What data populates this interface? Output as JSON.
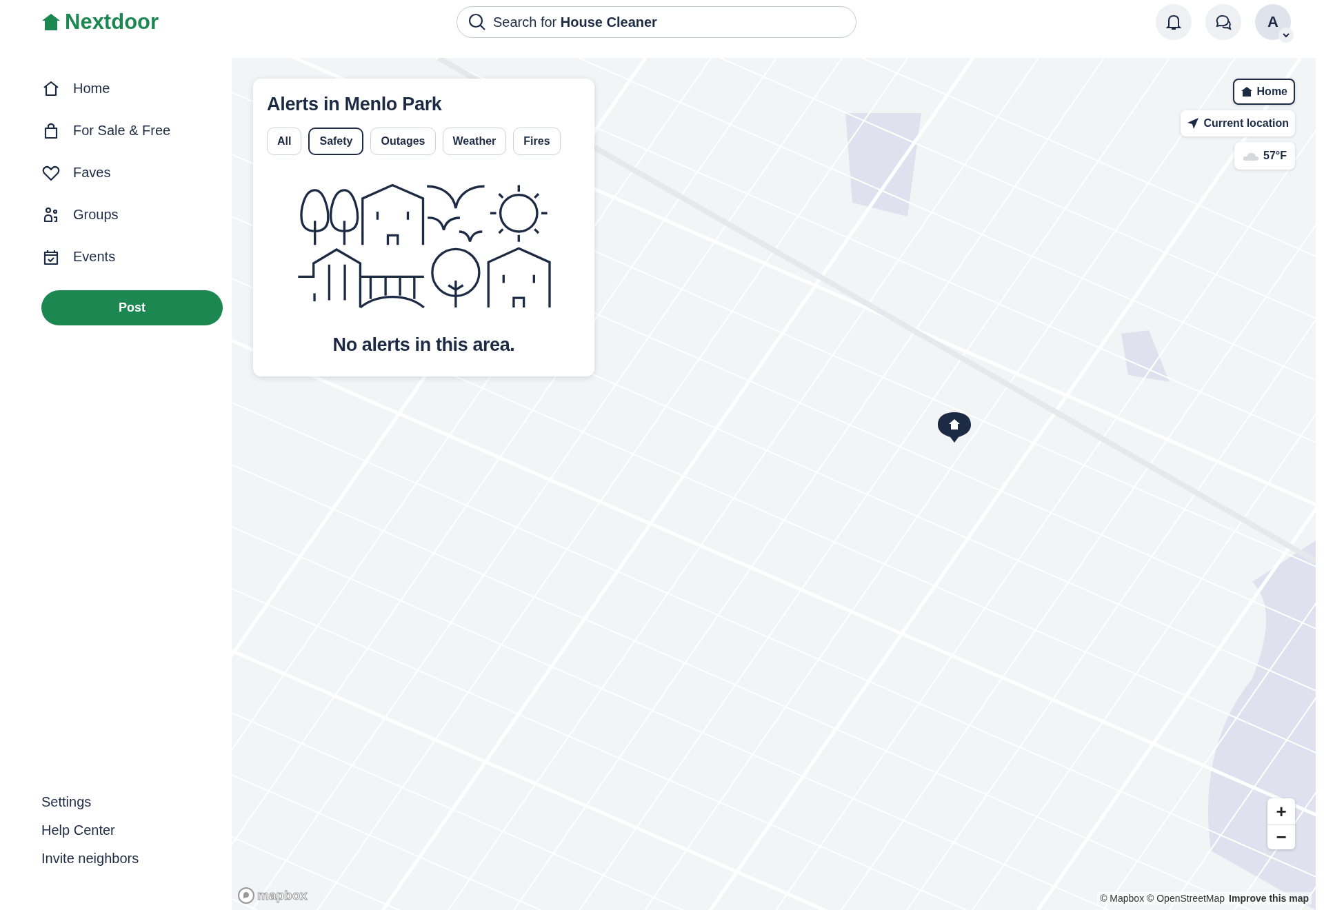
{
  "header": {
    "logo": "Nextdoor",
    "search": "Search for **House Cleaner**",
    "avatar": "A"
  },
  "sidebar": {
    "nav": [
      {
        "label": "Home",
        "kind": "home"
      },
      {
        "label": "For Sale & Free",
        "kind": "bag"
      },
      {
        "label": "Faves",
        "kind": "heart"
      },
      {
        "label": "Groups",
        "kind": "people"
      },
      {
        "label": "Events",
        "kind": "calendar"
      }
    ],
    "post": "Post",
    "footer_links": [
      "Settings",
      "Help Center",
      "Invite neighbors"
    ]
  },
  "alerts": {
    "title": "Alerts in Menlo Park",
    "filters": [
      {
        "label": "All",
        "selected": false
      },
      {
        "label": "Safety",
        "selected": true
      },
      {
        "label": "Outages",
        "selected": false
      },
      {
        "label": "Weather",
        "selected": false
      },
      {
        "label": "Fires",
        "selected": false
      }
    ],
    "empty": "No alerts in this area."
  },
  "map": {
    "home": "Home",
    "current_location": "Current location",
    "weather": "57°F",
    "zoom_in": "+",
    "zoom_out": "−",
    "logo": "mapbox",
    "attribution": "© Mapbox © OpenStreetMap",
    "improve": "Improve this map"
  }
}
